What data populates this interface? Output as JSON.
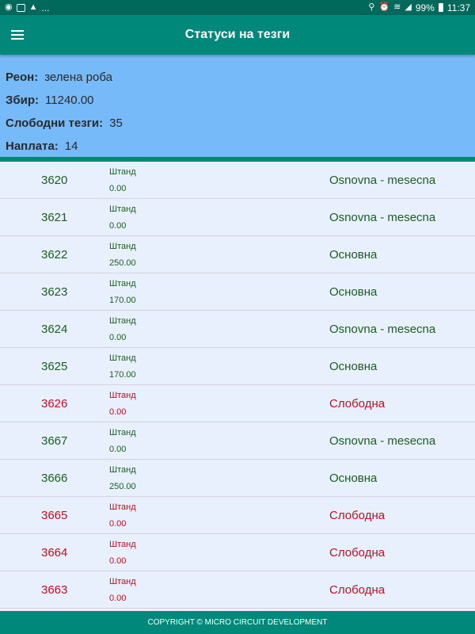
{
  "status_bar": {
    "left_icons": [
      "app-notification-icon",
      "image-icon",
      "warning-icon"
    ],
    "more": "...",
    "battery": "99%",
    "time": "11:37"
  },
  "app_bar": {
    "title": "Статуси на тезги",
    "menu_icon": "hamburger-menu-icon"
  },
  "info": {
    "region_label": "Реон:",
    "region_value": "зелена роба",
    "total_label": "Збир:",
    "total_value": "11240.00",
    "free_label": "Слободни тезги:",
    "free_value": "35",
    "paid_label": "Наплата:",
    "paid_value": "14"
  },
  "colors": {
    "status_bar": "#00695c",
    "app_bar": "#00897b",
    "info_panel": "#76baf9",
    "list_bg": "#e8f0fd",
    "taken_text": "#1b5e20",
    "free_text": "#c50e1f"
  },
  "rows": [
    {
      "number": "3620",
      "kind": "Штанд",
      "amount": "0.00",
      "status": "Osnovna - mesecna",
      "state": "taken"
    },
    {
      "number": "3621",
      "kind": "Штанд",
      "amount": "0.00",
      "status": "Osnovna - mesecna",
      "state": "taken"
    },
    {
      "number": "3622",
      "kind": "Штанд",
      "amount": "250.00",
      "status": "Основна",
      "state": "taken"
    },
    {
      "number": "3623",
      "kind": "Штанд",
      "amount": "170.00",
      "status": "Основна",
      "state": "taken"
    },
    {
      "number": "3624",
      "kind": "Штанд",
      "amount": "0.00",
      "status": "Osnovna - mesecna",
      "state": "taken"
    },
    {
      "number": "3625",
      "kind": "Штанд",
      "amount": "170.00",
      "status": "Основна",
      "state": "taken"
    },
    {
      "number": "3626",
      "kind": "Штанд",
      "amount": "0.00",
      "status": "Слободна",
      "state": "free"
    },
    {
      "number": "3667",
      "kind": "Штанд",
      "amount": "0.00",
      "status": "Osnovna - mesecna",
      "state": "taken"
    },
    {
      "number": "3666",
      "kind": "Штанд",
      "amount": "250.00",
      "status": "Основна",
      "state": "taken"
    },
    {
      "number": "3665",
      "kind": "Штанд",
      "amount": "0.00",
      "status": "Слободна",
      "state": "free"
    },
    {
      "number": "3664",
      "kind": "Штанд",
      "amount": "0.00",
      "status": "Слободна",
      "state": "free"
    },
    {
      "number": "3663",
      "kind": "Штанд",
      "amount": "0.00",
      "status": "Слободна",
      "state": "free"
    }
  ],
  "footer": {
    "text": "COPYRIGHT © MICRO CIRCUIT DEVELOPMENT"
  }
}
